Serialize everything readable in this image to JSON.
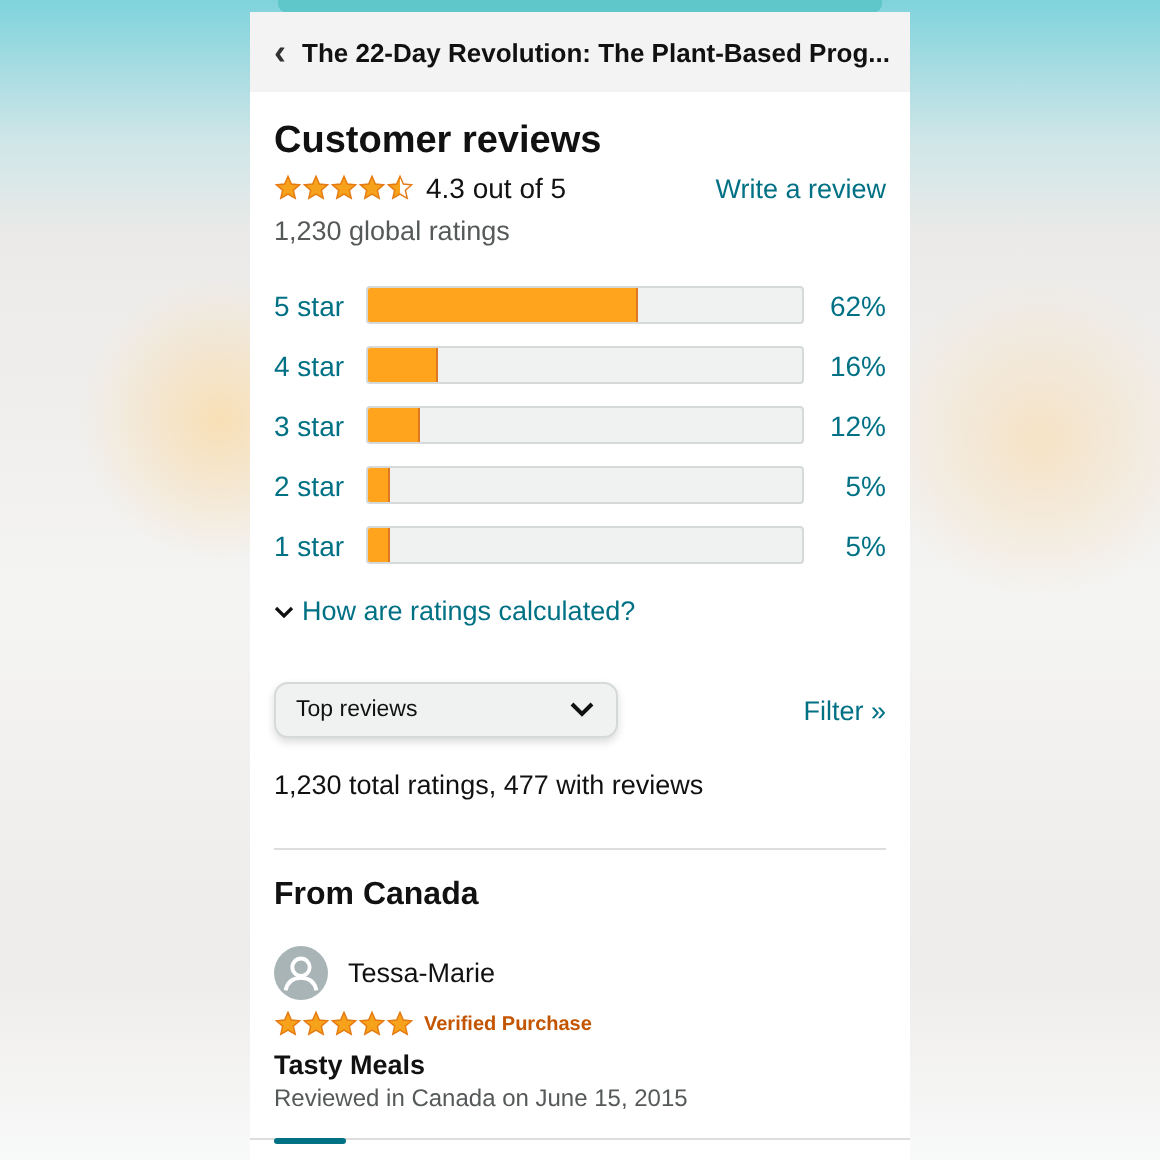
{
  "header": {
    "back_icon": "‹",
    "title": "The 22-Day Revolution: The Plant-Based Prog..."
  },
  "summary": {
    "heading": "Customer reviews",
    "stars": 4.5,
    "rating": "4.3 out of 5",
    "write_link": "Write a review",
    "global_ratings": "1,230 global ratings"
  },
  "histogram": [
    {
      "label": "5 star",
      "level": 0.62,
      "percent": "62%"
    },
    {
      "label": "4 star",
      "level": 0.16,
      "percent": "16%"
    },
    {
      "label": "3 star",
      "level": 0.12,
      "percent": "12%"
    },
    {
      "label": "2 star",
      "level": 0.05,
      "percent": "5%"
    },
    {
      "label": "1 star",
      "level": 0.05,
      "percent": "5%"
    }
  ],
  "how_link": "How are ratings calculated?",
  "sort": {
    "value": "Top reviews",
    "filter_link": "Filter »"
  },
  "totals": "1,230 total ratings, 477 with reviews",
  "section_heading": "From Canada",
  "review": {
    "author": "Tessa-Marie",
    "stars": 5,
    "badge": "Verified Purchase",
    "title": "Tasty Meals",
    "meta": "Reviewed in Canada on June 15, 2015"
  }
}
